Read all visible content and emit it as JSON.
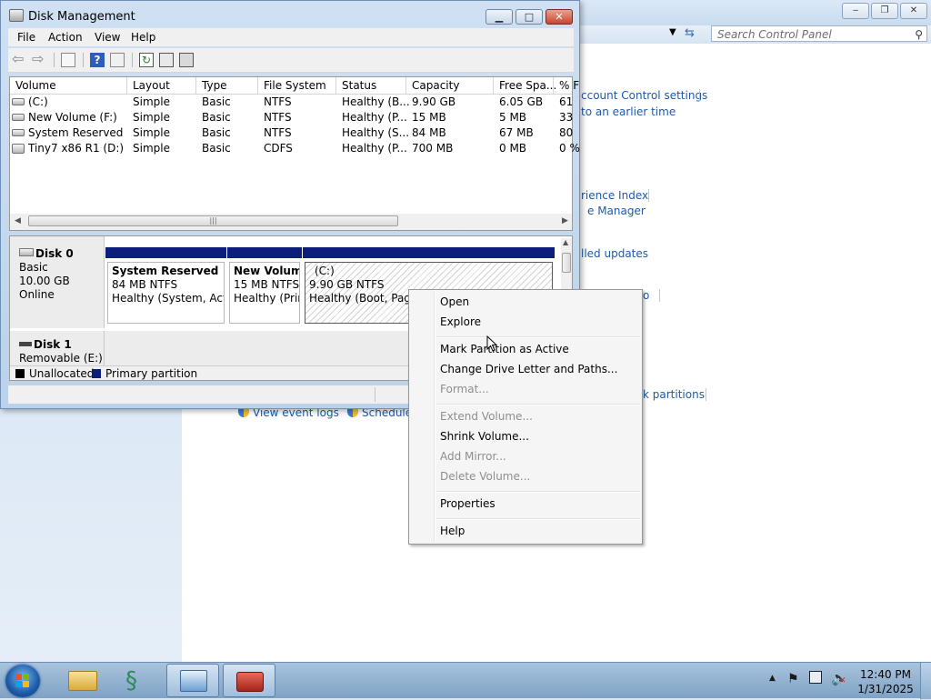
{
  "control_panel": {
    "search_placeholder": "Search Control Panel",
    "links": [
      "ccount Control settings",
      "to an earlier time",
      "rience Index",
      "e Manager",
      "lled updates",
      "o",
      "k partitions",
      "View event logs",
      "Schedule"
    ]
  },
  "disk_management": {
    "title": "Disk Management",
    "menu": [
      "File",
      "Action",
      "View",
      "Help"
    ],
    "columns": [
      "Volume",
      "Layout",
      "Type",
      "File System",
      "Status",
      "Capacity",
      "Free Spa...",
      "% F"
    ],
    "rows": [
      {
        "volume": "(C:)",
        "layout": "Simple",
        "type": "Basic",
        "fs": "NTFS",
        "status": "Healthy (B...",
        "capacity": "9.90 GB",
        "free": "6.05 GB",
        "pct": "61"
      },
      {
        "volume": "New Volume (F:)",
        "layout": "Simple",
        "type": "Basic",
        "fs": "NTFS",
        "status": "Healthy (P...",
        "capacity": "15 MB",
        "free": "5 MB",
        "pct": "33"
      },
      {
        "volume": "System Reserved",
        "layout": "Simple",
        "type": "Basic",
        "fs": "NTFS",
        "status": "Healthy (S...",
        "capacity": "84 MB",
        "free": "67 MB",
        "pct": "80"
      },
      {
        "volume": "Tiny7 x86 R1 (D:)",
        "layout": "Simple",
        "type": "Basic",
        "fs": "CDFS",
        "status": "Healthy (P...",
        "capacity": "700 MB",
        "free": "0 MB",
        "pct": "0 %"
      }
    ],
    "disk0": {
      "name": "Disk 0",
      "type": "Basic",
      "size": "10.00 GB",
      "state": "Online"
    },
    "disk1": {
      "name": "Disk 1",
      "type": "Removable (E:)"
    },
    "partitions": [
      {
        "name": "System Reserved",
        "size": "84 MB NTFS",
        "status": "Healthy (System, Activ"
      },
      {
        "name": "New Volum",
        "size": "15 MB NTFS",
        "status": "Healthy (Prir"
      },
      {
        "name": "(C:)",
        "size": "9.90 GB NTFS",
        "status": "Healthy (Boot, Page F"
      }
    ],
    "legend": {
      "unallocated": "Unallocated",
      "primary": "Primary partition"
    }
  },
  "context_menu": {
    "items": [
      {
        "label": "Open",
        "enabled": true
      },
      {
        "label": "Explore",
        "enabled": true
      },
      {
        "label": "Mark Partition as Active",
        "enabled": true
      },
      {
        "label": "Change Drive Letter and Paths...",
        "enabled": true
      },
      {
        "label": "Format...",
        "enabled": false
      },
      {
        "label": "Extend Volume...",
        "enabled": false
      },
      {
        "label": "Shrink Volume...",
        "enabled": true
      },
      {
        "label": "Add Mirror...",
        "enabled": false
      },
      {
        "label": "Delete Volume...",
        "enabled": false
      },
      {
        "label": "Properties",
        "enabled": true
      },
      {
        "label": "Help",
        "enabled": true
      }
    ]
  },
  "taskbar": {
    "time": "12:40 PM",
    "date": "1/31/2025"
  },
  "colors": {
    "primary_partition": "#0b1f7a",
    "unallocated": "#000000",
    "link": "#1e5aa8"
  }
}
